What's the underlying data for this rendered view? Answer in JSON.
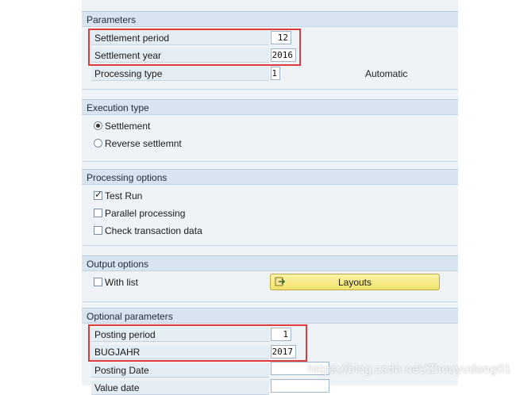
{
  "parameters": {
    "title": "Parameters",
    "settlement_period": {
      "label": "Settlement period",
      "value": "12"
    },
    "settlement_year": {
      "label": "Settlement year",
      "value": "2016"
    },
    "processing_type": {
      "label": "Processing type",
      "value": "1",
      "description": "Automatic"
    }
  },
  "execution_type": {
    "title": "Execution type",
    "options": [
      {
        "label": "Settlement",
        "selected": true
      },
      {
        "label": "Reverse settlemnt",
        "selected": false
      }
    ]
  },
  "processing_options": {
    "title": "Processing options",
    "options": [
      {
        "label": "Test Run",
        "checked": true
      },
      {
        "label": "Parallel processing",
        "checked": false
      },
      {
        "label": "Check transaction data",
        "checked": false
      }
    ]
  },
  "output_options": {
    "title": "Output options",
    "with_list": {
      "label": "With list",
      "checked": false
    },
    "layouts_button": "Layouts"
  },
  "optional_parameters": {
    "title": "Optional parameters",
    "posting_period": {
      "label": "Posting period",
      "value": "1"
    },
    "bugjahr": {
      "label": "BUGJAHR",
      "value": "2017"
    },
    "posting_date": {
      "label": "Posting Date",
      "value": ""
    },
    "value_date": {
      "label": "Value date",
      "value": ""
    }
  },
  "watermark": "https://blog.csdn.net/Zhouyudong01",
  "colors": {
    "highlight": "#e03b3b",
    "header_bg": "#d8e4f0",
    "button": "#f2e36c"
  }
}
